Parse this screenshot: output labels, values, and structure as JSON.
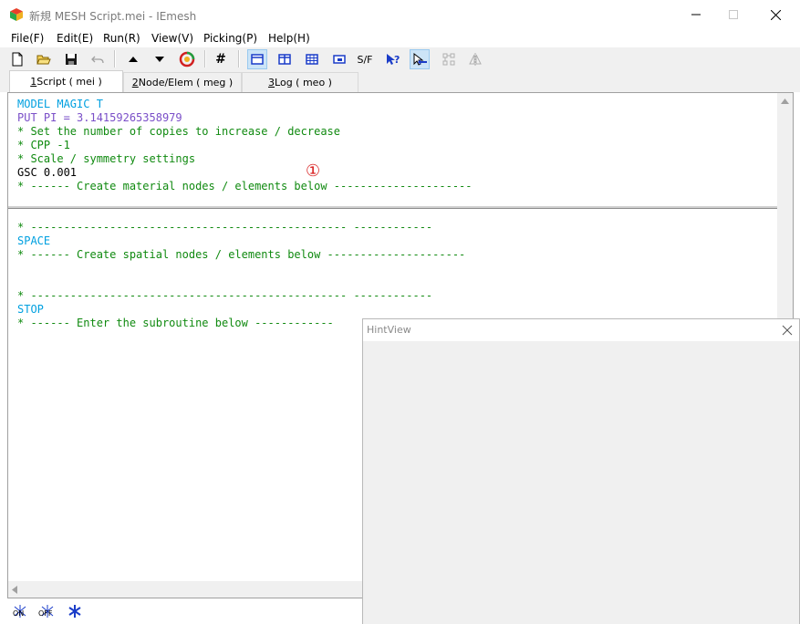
{
  "window": {
    "title": "新規 MESH Script.mei - IEmesh",
    "icon": "iemesh-cube-icon"
  },
  "menu": {
    "items": [
      "File(F)",
      "Edit(E)",
      "Run(R)",
      "View(V)",
      "Picking(P)",
      "Help(H)"
    ]
  },
  "toolbar": {
    "sf_label": "S/F",
    "hash_label": "#"
  },
  "tabs": [
    {
      "num": "1",
      "label": " Script ( mei )"
    },
    {
      "num": "2",
      "label": " Node/Elem ( meg )"
    },
    {
      "num": "3",
      "label": " Log ( meo )"
    }
  ],
  "editor": {
    "top_lines": [
      {
        "text": "MODEL MAGIC T"
      },
      {
        "text": "PUT PI = 3.14159265358979"
      },
      {
        "text": "* Set the number of copies to increase / decrease"
      },
      {
        "text": "* CPP -1"
      },
      {
        "text": "* Scale / symmetry settings"
      },
      {
        "text": "GSC 0.001"
      },
      {
        "text": "* ------ Create material nodes / elements below ---------------------"
      }
    ],
    "bottom_lines": [
      {
        "text": "* ------------------------------------------------ ------------"
      },
      {
        "text": "SPACE"
      },
      {
        "text": "* ------ Create spatial nodes / elements below ---------------------"
      },
      {
        "text": ""
      },
      {
        "text": ""
      },
      {
        "text": "* ------------------------------------------------ ------------"
      },
      {
        "text": "STOP"
      },
      {
        "text": "* ------ Enter the subroutine below ------------"
      }
    ],
    "marker": "①"
  },
  "bottom_toolbar": {
    "on_label": "ON",
    "off_label": "OFF"
  },
  "hintview": {
    "title": "HintView"
  },
  "colors": {
    "keyword": "#00a0e0",
    "put": "#7a4fc8",
    "comment": "#108a10",
    "marker": "#d81e1e",
    "toolbar_active": "#cce4f7"
  }
}
